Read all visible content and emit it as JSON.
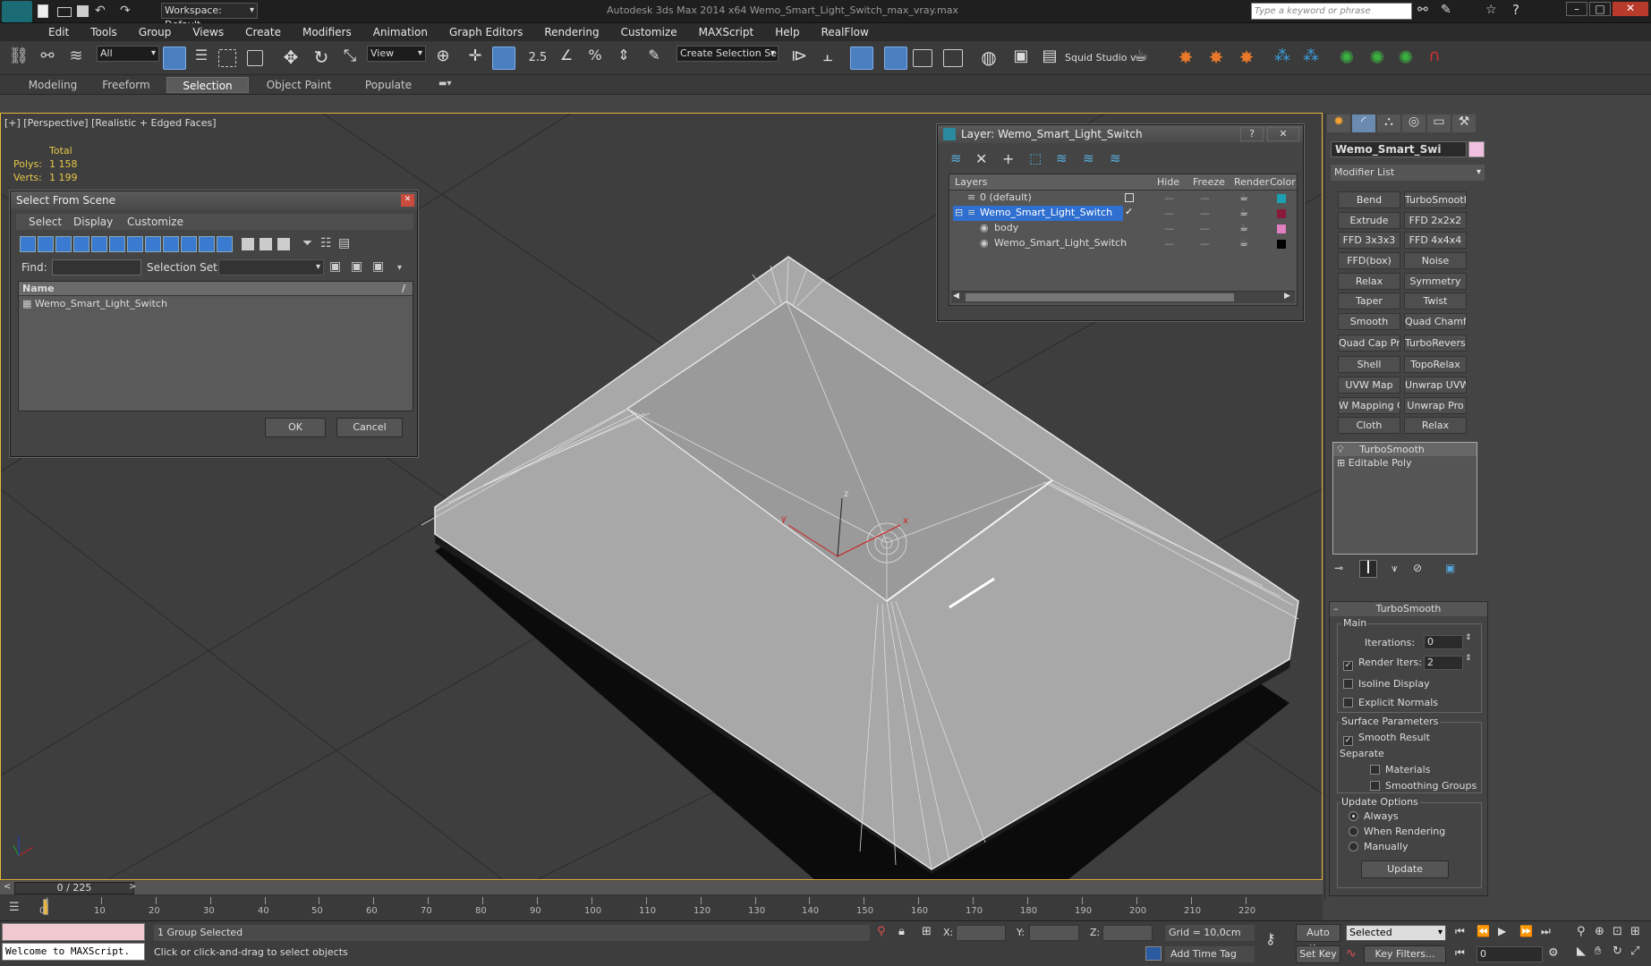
{
  "titlebar": {
    "workspace": "Workspace: Default",
    "title": "Autodesk 3ds Max  2014 x64     Wemo_Smart_Light_Switch_max_vray.max",
    "search_placeholder": "Type a keyword or phrase"
  },
  "menu": [
    "Edit",
    "Tools",
    "Group",
    "Views",
    "Create",
    "Modifiers",
    "Animation",
    "Graph Editors",
    "Rendering",
    "Customize",
    "MAXScript",
    "Help",
    "RealFlow"
  ],
  "toolbar": {
    "filter": "All",
    "ref_coord": "View",
    "selection_set": "Create Selection Se",
    "squid": "Squid Studio v"
  },
  "ribbon_tabs": [
    "Modeling",
    "Freeform",
    "Selection",
    "Object Paint",
    "Populate"
  ],
  "viewport": {
    "label": "[+] [Perspective] [Realistic + Edged Faces]",
    "stats_total": "Total",
    "polys_label": "Polys:",
    "polys_value": "1 158",
    "verts_label": "Verts:",
    "verts_value": "1 199",
    "axis_x": "x",
    "axis_y": "y",
    "axis_z": "z"
  },
  "select_dialog": {
    "title": "Select From Scene",
    "menu": [
      "Select",
      "Display",
      "Customize"
    ],
    "find_label": "Find:",
    "selset_label": "Selection Set:",
    "col_name": "Name",
    "items": [
      "Wemo_Smart_Light_Switch"
    ],
    "ok": "OK",
    "cancel": "Cancel"
  },
  "layer_dialog": {
    "title": "Layer: Wemo_Smart_Light_Switch",
    "help": "?",
    "close": "✕",
    "cols": [
      "Layers",
      "Hide",
      "Freeze",
      "Render",
      "Color"
    ],
    "rows": [
      {
        "name": "0 (default)",
        "color": "#1aa0b0"
      },
      {
        "name": "Wemo_Smart_Light_Switch",
        "color": "#8a1a3a"
      },
      {
        "name": "body",
        "color": "#e080c0"
      },
      {
        "name": "Wemo_Smart_Light_Switch",
        "color": "#000000"
      }
    ]
  },
  "modifier_panel": {
    "object_name": "Wemo_Smart_Swi",
    "modifier_list": "Modifier List",
    "buttons": [
      "Bend",
      "TurboSmooth",
      "Extrude",
      "FFD 2x2x2",
      "FFD 3x3x3",
      "FFD 4x4x4",
      "FFD(box)",
      "Noise",
      "Relax",
      "Symmetry",
      "Taper",
      "Twist",
      "Smooth",
      "Quad Chamfer",
      "Quad Cap Pro",
      "TurboReverse",
      "Shell",
      "TopoRelax",
      "UVW Map",
      "Unwrap UVW",
      "W Mapping Cle",
      "Unwrap Pro",
      "Cloth",
      "Relax"
    ],
    "stack": [
      "TurboSmooth",
      "Editable Poly"
    ],
    "rollout_title": "TurboSmooth",
    "main_label": "Main",
    "iterations_label": "Iterations:",
    "iterations_value": "0",
    "render_iters_label": "Render Iters:",
    "render_iters_value": "2",
    "isoline": "Isoline Display",
    "explicit": "Explicit Normals",
    "surface_params": "Surface Parameters",
    "smooth_result": "Smooth Result",
    "separate": "Separate",
    "materials": "Materials",
    "smoothing_groups": "Smoothing Groups",
    "update_options": "Update Options",
    "always": "Always",
    "when_rendering": "When Rendering",
    "manually": "Manually",
    "update_btn": "Update"
  },
  "timeline": {
    "frame": "0 / 225",
    "ticks": [
      "0",
      "10",
      "20",
      "30",
      "40",
      "50",
      "60",
      "70",
      "80",
      "90",
      "100",
      "110",
      "120",
      "130",
      "140",
      "150",
      "160",
      "170",
      "180",
      "190",
      "200",
      "210",
      "220"
    ]
  },
  "status": {
    "maxscript": "Welcome to MAXScript.",
    "group_selected": "1 Group Selected",
    "prompt": "Click or click-and-drag to select objects",
    "x_label": "X:",
    "y_label": "Y:",
    "z_label": "Z:",
    "grid": "Grid = 10,0cm",
    "add_time_tag": "Add Time Tag",
    "auto_key": "Auto Key",
    "selected": "Selected",
    "set_key": "Set Key",
    "key_filters": "Key Filters...",
    "frame_value": "0"
  }
}
